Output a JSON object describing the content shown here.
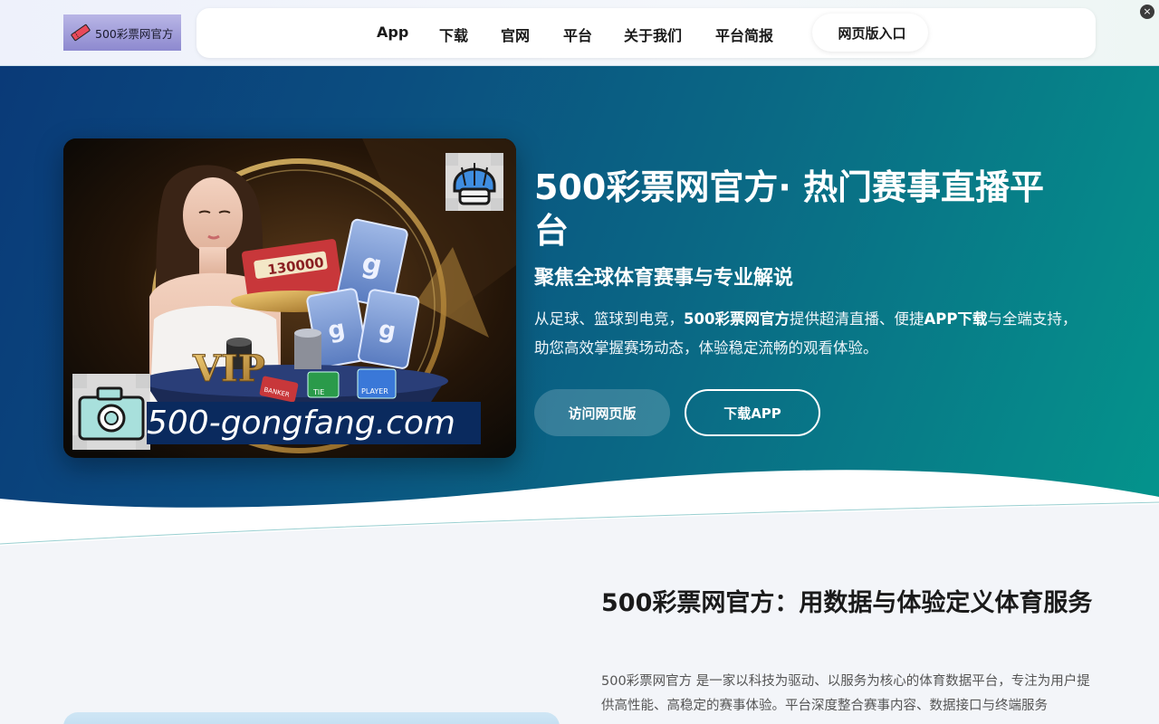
{
  "header": {
    "logo_text": "500彩票网官方",
    "nav": [
      {
        "label": "App"
      },
      {
        "label": "下载"
      },
      {
        "label": "官网"
      },
      {
        "label": "平台"
      },
      {
        "label": "关于我们"
      },
      {
        "label": "平台简报"
      }
    ],
    "web_entry_icon": "",
    "web_entry_label": "网页版入口",
    "close_label": "×"
  },
  "hero": {
    "domain_text": "500-gongfang.com",
    "title": "500彩票网官方· 热门赛事直播平台",
    "subtitle": "聚焦全球体育赛事与专业解说",
    "desc_prefix": "从足球、篮球到电竞，",
    "desc_brand": "500彩票网官方",
    "desc_mid": "提供超清直播、便捷",
    "desc_app": "APP下载",
    "desc_suffix": "与全端支持， 助您高效掌握赛场动态，体验稳定流畅的观看体验。",
    "btn_visit": "访问网页版",
    "btn_download": "下载APP",
    "card_texts": {
      "vip": "VIP",
      "chip": "130000",
      "tie": "TIE",
      "player": "PLAYER",
      "banker": "BANKER"
    }
  },
  "about": {
    "title": "500彩票网官方：用数据与体验定义体育服务",
    "text": "500彩票网官方 是一家以科技为驱动、以服务为核心的体育数据平台，专注为用户提供高性能、高稳定的赛事体验。平台深度整合赛事内容、数据接口与终端服务"
  },
  "colors": {
    "hero_start": "#0a3a78",
    "hero_end": "#04958c",
    "banner": "#0a2a5e"
  },
  "icons": [
    "ticket-icon",
    "helmet-icon",
    "camera-icon"
  ]
}
